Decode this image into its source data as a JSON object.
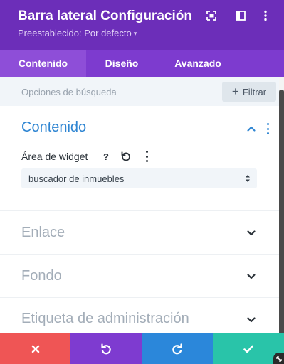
{
  "header": {
    "title": "Barra lateral Configuración",
    "preset": "Preestablecido: Por defecto",
    "preset_caret": "▾",
    "icons": [
      "expand-icon",
      "sidebar-toggle-icon",
      "more-vertical-icon"
    ]
  },
  "tabs": [
    {
      "label": "Contenido",
      "active": true
    },
    {
      "label": "Diseño",
      "active": false
    },
    {
      "label": "Avanzado",
      "active": false
    }
  ],
  "search": {
    "placeholder": "Opciones de búsqueda",
    "filter_label": "Filtrar",
    "filter_icon": "+"
  },
  "sections": {
    "content": {
      "title": "Contenido",
      "expanded": true,
      "field": {
        "label": "Área de widget",
        "help_icon": "?",
        "select_value": "buscador de inmuebles"
      }
    },
    "link": {
      "title": "Enlace",
      "expanded": false
    },
    "background": {
      "title": "Fondo",
      "expanded": false
    },
    "admin_label": {
      "title": "Etiqueta de administración",
      "expanded": false
    }
  },
  "actions": [
    {
      "name": "cancel",
      "color": "#ef5555",
      "icon": "close-icon"
    },
    {
      "name": "undo",
      "color": "#7e3bd0",
      "icon": "undo-icon"
    },
    {
      "name": "redo",
      "color": "#2b87da",
      "icon": "redo-icon"
    },
    {
      "name": "save",
      "color": "#29c4a9",
      "icon": "check-icon"
    }
  ],
  "colors": {
    "header_bg": "#6c2eb9",
    "tabs_bg": "#7d3bcf",
    "active_tab_bg": "#8e4ed8",
    "accent_blue": "#2e85d2",
    "muted_text": "#a3adb8"
  }
}
